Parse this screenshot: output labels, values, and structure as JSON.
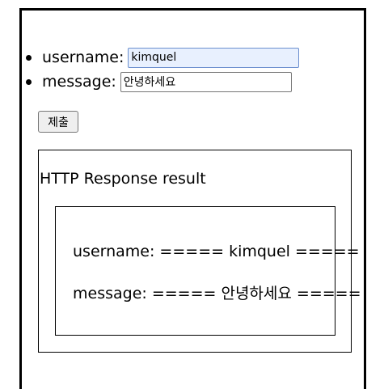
{
  "form": {
    "fields": [
      {
        "label": "username:",
        "value": "kimquel",
        "focused": true
      },
      {
        "label": "message:",
        "value": "안녕하세요",
        "focused": false
      }
    ],
    "submit_label": "제출"
  },
  "result": {
    "title": "HTTP Response result",
    "username_line": "username: ===== kimquel =====",
    "message_line": "message: ===== 안녕하세요 ====="
  },
  "colors": {
    "focused_input_bg": "#e8f0fe",
    "button_bg": "#efefef"
  }
}
